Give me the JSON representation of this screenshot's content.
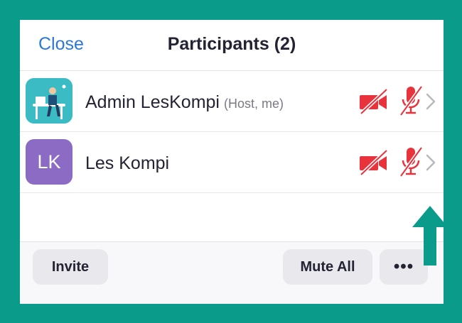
{
  "header": {
    "close_label": "Close",
    "title": "Participants (2)"
  },
  "participants": [
    {
      "name": "Admin LesKompi",
      "role": "(Host, me)",
      "avatar": "illustration",
      "video": "off",
      "audio": "muted"
    },
    {
      "name": "Les Kompi",
      "initials": "LK",
      "avatar": "initials",
      "video": "off",
      "audio": "muted"
    }
  ],
  "footer": {
    "invite_label": "Invite",
    "mute_all_label": "Mute All",
    "more_label": "•••"
  },
  "colors": {
    "frame": "#0b9b8a",
    "accent_blue": "#2d78d6",
    "muted_red": "#e8333d",
    "avatar_purple": "#8b6bc4",
    "avatar_teal": "#3bbcc4",
    "arrow": "#0b9b8a"
  },
  "icons": {
    "camera": "video-off-icon",
    "microphone": "mic-muted-icon",
    "chevron": "chevron-right-icon",
    "annotation": "up-arrow-icon"
  }
}
